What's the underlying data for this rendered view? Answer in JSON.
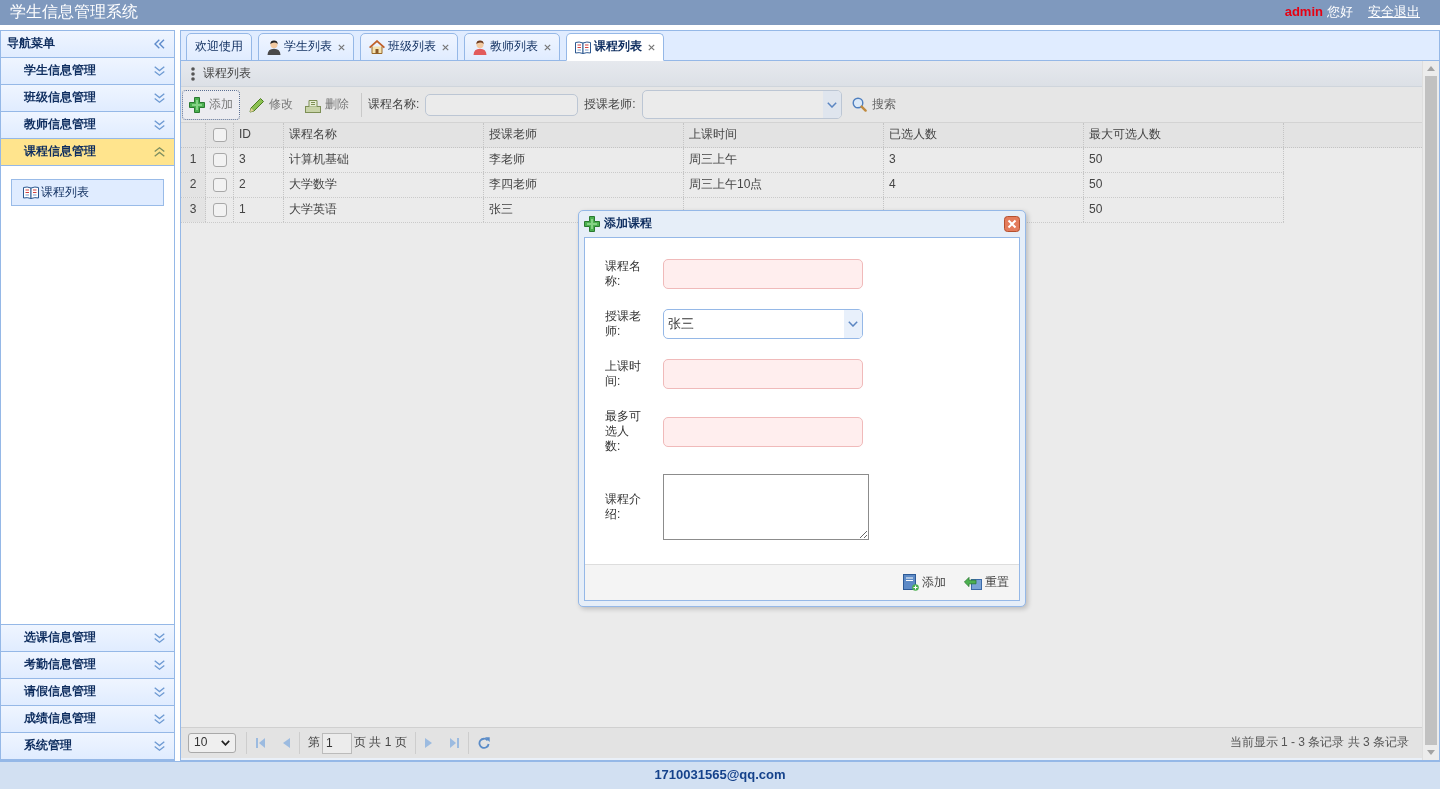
{
  "header": {
    "title": "学生信息管理系统",
    "user": "admin",
    "greeting": "您好",
    "logout": "安全退出"
  },
  "sidebar": {
    "title": "导航菜单",
    "groups": [
      {
        "label": "学生信息管理",
        "expanded": false
      },
      {
        "label": "班级信息管理",
        "expanded": false
      },
      {
        "label": "教师信息管理",
        "expanded": false
      },
      {
        "label": "课程信息管理",
        "expanded": true,
        "children": [
          {
            "label": "课程列表",
            "selected": true
          }
        ]
      },
      {
        "label": "选课信息管理",
        "expanded": false
      },
      {
        "label": "考勤信息管理",
        "expanded": false
      },
      {
        "label": "请假信息管理",
        "expanded": false
      },
      {
        "label": "成绩信息管理",
        "expanded": false
      },
      {
        "label": "系统管理",
        "expanded": false
      }
    ]
  },
  "tabs": [
    {
      "label": "欢迎使用",
      "kind": "welcome",
      "closable": false,
      "selected": false
    },
    {
      "label": "学生列表",
      "kind": "student",
      "closable": true,
      "selected": false
    },
    {
      "label": "班级列表",
      "kind": "class",
      "closable": true,
      "selected": false
    },
    {
      "label": "教师列表",
      "kind": "teacher",
      "closable": true,
      "selected": false
    },
    {
      "label": "课程列表",
      "kind": "course",
      "closable": true,
      "selected": true
    }
  ],
  "panel": {
    "title": "课程列表"
  },
  "toolbar": {
    "buttons": [
      {
        "label": "添加",
        "kind": "add",
        "focused": true
      },
      {
        "label": "修改",
        "kind": "edit",
        "focused": false
      },
      {
        "label": "删除",
        "kind": "delete",
        "focused": false
      }
    ],
    "filters": [
      {
        "label": "课程名称:",
        "kind": "text"
      },
      {
        "label": "授课老师:",
        "kind": "combo"
      }
    ],
    "search": "搜索"
  },
  "table": {
    "all_checked": false,
    "columns": [
      "ID",
      "课程名称",
      "授课老师",
      "上课时间",
      "已选人数",
      "最大可选人数"
    ],
    "rows": [
      {
        "number": "1",
        "checked": false,
        "cells": [
          "3",
          "计算机基础",
          "李老师",
          "周三上午",
          "3",
          "50"
        ]
      },
      {
        "number": "2",
        "checked": false,
        "cells": [
          "2",
          "大学数学",
          "李四老师",
          "周三上午10点",
          "4",
          "50"
        ]
      },
      {
        "number": "3",
        "checked": false,
        "cells": [
          "1",
          "大学英语",
          "张三",
          null,
          null,
          "50"
        ]
      }
    ]
  },
  "pager": {
    "page_size": "10",
    "page_prefix": "第",
    "page": "1",
    "page_suffix": "页 共 1 页",
    "summary": "当前显示 1 - 3 条记录 共 3 条记录"
  },
  "dialog": {
    "title": "添加课程",
    "fields": [
      {
        "label": "课程名称:",
        "kind": "text",
        "invalid": true
      },
      {
        "label": "授课老师:",
        "kind": "combo",
        "value": "张三",
        "invalid": false
      },
      {
        "label": "上课时间:",
        "kind": "text",
        "invalid": true
      },
      {
        "label": "最多可选人数:",
        "kind": "text",
        "invalid": true
      },
      {
        "label": "课程介绍:",
        "kind": "textarea",
        "invalid": false
      }
    ],
    "buttons": [
      {
        "label": "添加",
        "kind": "save"
      },
      {
        "label": "重置",
        "kind": "reset"
      }
    ]
  },
  "footer": {
    "text": "1710031565@qq.com"
  }
}
